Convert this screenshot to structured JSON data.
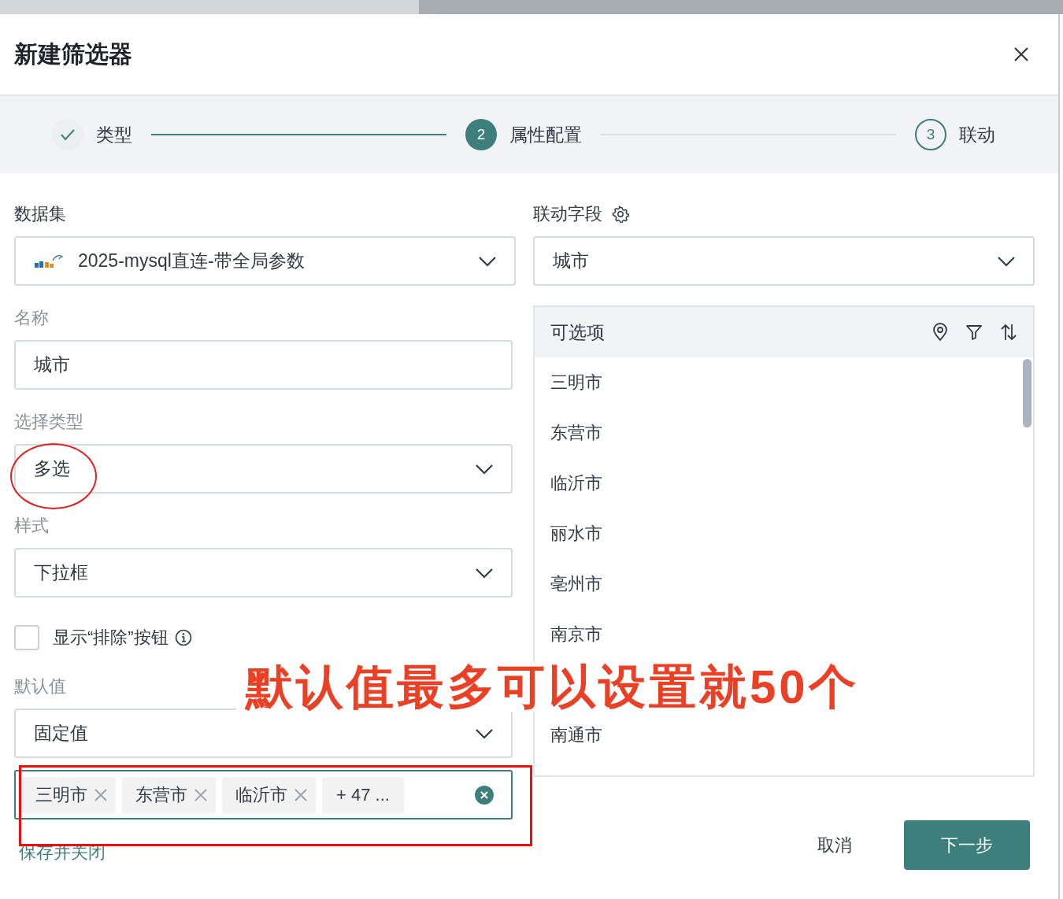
{
  "dialog": {
    "title": "新建筛选器"
  },
  "steps": [
    {
      "label": "类型",
      "completed": true,
      "selected": false
    },
    {
      "label": "属性配置",
      "number": "2",
      "completed": false,
      "selected": true
    },
    {
      "label": "联动",
      "number": "3",
      "completed": false,
      "selected": false
    }
  ],
  "form": {
    "dataset": {
      "label": "数据集",
      "dimmed": false,
      "value": "2025-mysql直连-带全局参数"
    },
    "name": {
      "label": "名称",
      "dimmed": true,
      "value": "城市"
    },
    "select_type": {
      "label": "选择类型",
      "dimmed": true,
      "value": "多选"
    },
    "style": {
      "label": "样式",
      "dimmed": true,
      "value": "下拉框"
    },
    "exclude_toggle": {
      "label": "显示“排除”按钮",
      "checked": false
    },
    "default_value": {
      "label": "默认值",
      "dimmed": true,
      "value": "固定值",
      "tags": [
        "三明市",
        "东营市",
        "临沂市"
      ],
      "more": "+ 47 ..."
    }
  },
  "linked_field": {
    "label": "联动字段",
    "value": "城市"
  },
  "options": {
    "title": "可选项",
    "items": [
      "三明市",
      "东营市",
      "临沂市",
      "丽水市",
      "亳州市",
      "南京市",
      "南通市"
    ]
  },
  "footer": {
    "save_link": "保存并关闭",
    "cancel": "取消",
    "next": "下一步"
  },
  "annotation": {
    "note": "默认值最多可以设置就50个"
  }
}
